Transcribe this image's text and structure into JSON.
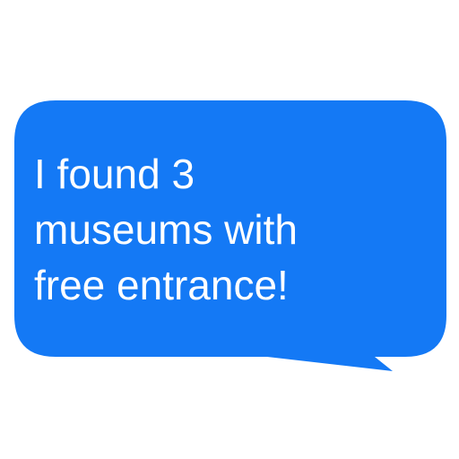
{
  "message": {
    "text": "I found 3\nmuseums with\nfree entrance!",
    "direction": "outgoing",
    "bubble_color": "#1479F5",
    "text_color": "#FFFFFF"
  }
}
